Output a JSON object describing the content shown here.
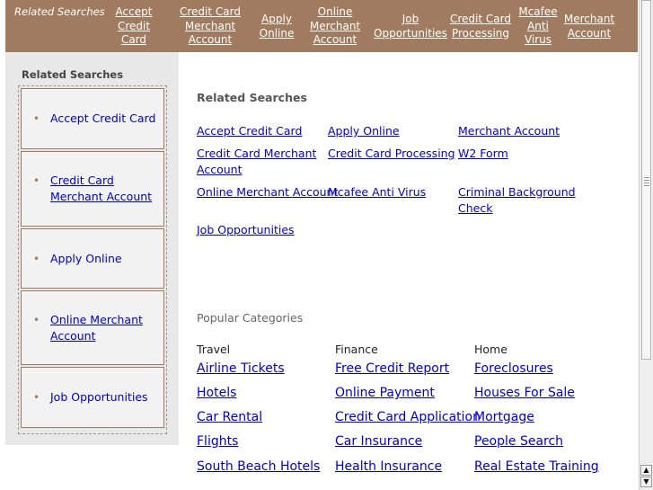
{
  "topbar": {
    "intro": "Related Searches",
    "items": [
      {
        "lines": [
          "Accept",
          "Credit",
          "Card"
        ]
      },
      {
        "lines": [
          "Credit Card",
          "Merchant",
          "Account"
        ]
      },
      {
        "lines": [
          "Apply",
          "Online"
        ]
      },
      {
        "lines": [
          "Online",
          "Merchant",
          "Account"
        ]
      },
      {
        "lines": [
          "Job",
          "Opportunities"
        ]
      },
      {
        "lines": [
          "Credit Card",
          "Processing"
        ]
      },
      {
        "lines": [
          "Mcafee",
          "Anti",
          "Virus"
        ]
      },
      {
        "lines": [
          "Merchant",
          "Account"
        ]
      }
    ]
  },
  "sidebar": {
    "title": "Related Searches",
    "bullet": "•",
    "items": [
      {
        "label": "Accept Credit Card"
      },
      {
        "label": "Credit Card Merchant Account"
      },
      {
        "label": "Apply Online"
      },
      {
        "label": "Online Merchant Account"
      },
      {
        "label": "Job Opportunities"
      }
    ]
  },
  "related": {
    "title": "Related Searches",
    "links": [
      "Accept Credit Card",
      "Apply Online",
      "Merchant Account",
      "Credit Card Merchant Account",
      "Credit Card Processing",
      "W2 Form",
      "Online Merchant Account",
      "Mcafee Anti Virus",
      "Criminal Background Check",
      "Job Opportunities"
    ]
  },
  "categories": {
    "title": "Popular Categories",
    "columns": [
      {
        "heading": "Travel",
        "links": [
          "Airline Tickets",
          "Hotels",
          "Car Rental",
          "Flights",
          "South Beach Hotels"
        ]
      },
      {
        "heading": "Finance",
        "links": [
          "Free Credit Report",
          "Online Payment",
          "Credit Card Application",
          "Car Insurance",
          "Health Insurance"
        ]
      },
      {
        "heading": "Home",
        "links": [
          "Foreclosures",
          "Houses For Sale",
          "Mortgage",
          "People Search",
          "Real Estate Training"
        ]
      }
    ]
  },
  "scrollbar": {
    "up_glyph": "▲",
    "down_glyph": "▼"
  }
}
